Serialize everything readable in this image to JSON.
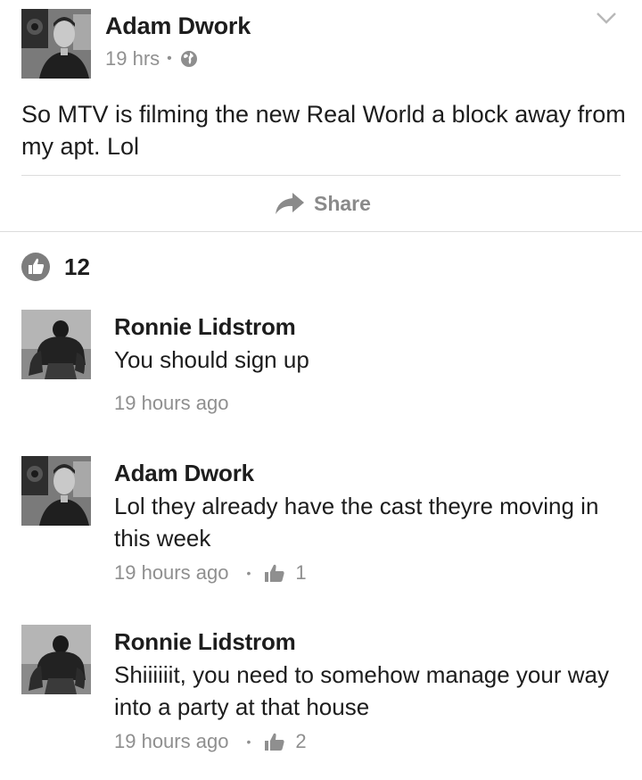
{
  "post": {
    "author": "Adam Dwork",
    "time": "19 hrs",
    "separator": "•",
    "text": "So MTV is filming the new Real World a block away from my apt. Lol",
    "share_label": "Share",
    "like_count": "12",
    "privacy_icon": "globe-icon",
    "menu_icon": "chevron-down-icon"
  },
  "comments": [
    {
      "author": "Ronnie Lidstrom",
      "text": "You should sign up",
      "time": "19 hours ago",
      "separator": "",
      "likes": ""
    },
    {
      "author": "Adam Dwork",
      "text": "Lol they already have the cast theyre moving in this week",
      "time": "19 hours ago",
      "separator": "•",
      "likes": "1"
    },
    {
      "author": "Ronnie Lidstrom",
      "text": "Shiiiiiit, you need to somehow manage your way into a party at that house",
      "time": "19 hours ago",
      "separator": "•",
      "likes": "2"
    }
  ],
  "colors": {
    "text": "#1d1d1d",
    "muted": "#8f8f8f",
    "divider": "#dcdcdc",
    "icon": "#8a8a8a"
  }
}
